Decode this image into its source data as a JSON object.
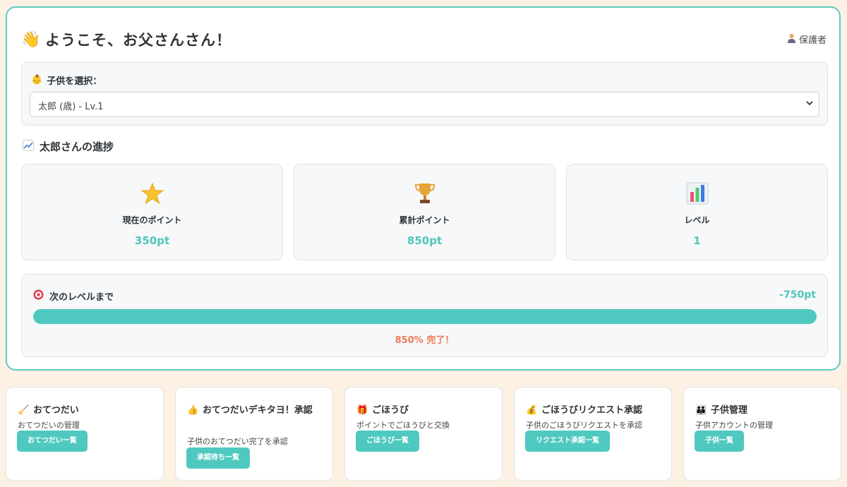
{
  "header": {
    "welcome": "ようこそ、お父さんさん！",
    "role": "保護者"
  },
  "child_select": {
    "label": "子供を選択：",
    "selected": "太郎 (歳) - Lv.1"
  },
  "progress": {
    "heading": "太郎さんの進捗",
    "stats": [
      {
        "icon": "star-icon",
        "label": "現在のポイント",
        "value": "350pt"
      },
      {
        "icon": "trophy-icon",
        "label": "累計ポイント",
        "value": "850pt"
      },
      {
        "icon": "bar-chart-icon",
        "label": "レベル",
        "value": "1"
      }
    ]
  },
  "next_level": {
    "label": "次のレベルまで",
    "remaining": "-750pt",
    "progress_percent": 100,
    "complete_text": "850% 完了！"
  },
  "menu": [
    {
      "icon": "broom-icon",
      "title": "おてつだい",
      "desc": "おてつだいの管理",
      "button": "おてつだい一覧"
    },
    {
      "icon": "thumbs-up-icon",
      "title": "おてつだいデキタヨ！承認",
      "desc": "子供のおてつだい完了を承認",
      "button": "承認待ち一覧"
    },
    {
      "icon": "gift-icon",
      "title": "ごほうび",
      "desc": "ポイントでごほうびと交換",
      "button": "ごほうび一覧"
    },
    {
      "icon": "money-bag-icon",
      "title": "ごほうびリクエスト承認",
      "desc": "子供のごほうびリクエストを承認",
      "button": "リクエスト承認一覧"
    },
    {
      "icon": "family-icon",
      "title": "子供管理",
      "desc": "子供アカウントの管理",
      "button": "子供一覧"
    }
  ],
  "colors": {
    "accent": "#4fc9c0",
    "background": "#fdf1e4",
    "complete_text": "#f07a55"
  }
}
